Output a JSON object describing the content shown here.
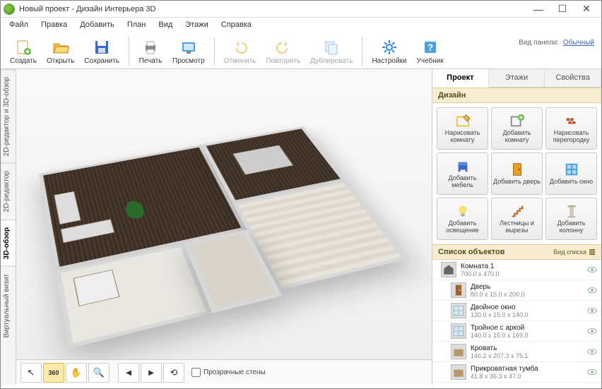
{
  "window": {
    "title": "Новый проект - Дизайн Интерьера 3D"
  },
  "menu": [
    "Файл",
    "Правка",
    "Добавить",
    "План",
    "Вид",
    "Этажи",
    "Справка"
  ],
  "toolbar": [
    {
      "id": "create",
      "label": "Создать",
      "icon": "#ffb030",
      "disabled": false
    },
    {
      "id": "open",
      "label": "Открыть",
      "icon": "#f0a020",
      "disabled": false
    },
    {
      "id": "save",
      "label": "Сохранить",
      "icon": "#2a5cc0",
      "disabled": false
    },
    {
      "sep": true
    },
    {
      "id": "print",
      "label": "Печать",
      "icon": "#888",
      "disabled": false
    },
    {
      "id": "view",
      "label": "Просмотр",
      "icon": "#2a8ad8",
      "disabled": false
    },
    {
      "sep": true
    },
    {
      "id": "undo",
      "label": "Отменить",
      "icon": "#f0a020",
      "disabled": true
    },
    {
      "id": "redo",
      "label": "Повторить",
      "icon": "#f0a020",
      "disabled": true
    },
    {
      "id": "duplicate",
      "label": "Дублировать",
      "icon": "#2a8ad8",
      "disabled": true
    },
    {
      "sep": true
    },
    {
      "id": "settings",
      "label": "Настройки",
      "icon": "#2a8ad8",
      "disabled": false
    },
    {
      "id": "tutorial",
      "label": "Учебник",
      "icon": "#2a8ad8",
      "disabled": false
    }
  ],
  "panelview": {
    "label": "Вид панели:",
    "value": "Обычный"
  },
  "sidetabs": [
    {
      "id": "2d-3d",
      "label": "2D-редактор и 3D-обзор",
      "active": false
    },
    {
      "id": "2d",
      "label": "2D-редактор",
      "active": false
    },
    {
      "id": "3d",
      "label": "3D-обзор",
      "active": true
    },
    {
      "id": "virtual",
      "label": "Виртуальный визит",
      "active": false
    }
  ],
  "viewtools": {
    "transparent_walls": "Прозрачные стены"
  },
  "tabs": [
    {
      "id": "project",
      "label": "Проект",
      "active": true
    },
    {
      "id": "floors",
      "label": "Этажи",
      "active": false
    },
    {
      "id": "props",
      "label": "Свойства",
      "active": false
    }
  ],
  "section_design": "Дизайн",
  "tools": [
    {
      "id": "draw-room",
      "label": "Нарисовать комнату",
      "color": "#e8c048"
    },
    {
      "id": "add-room",
      "label": "Добавить комнату",
      "color": "#48b048"
    },
    {
      "id": "draw-partition",
      "label": "Нарисовать перегородку",
      "color": "#c05030"
    },
    {
      "id": "add-furniture",
      "label": "Добавить мебель",
      "color": "#3a6ad0"
    },
    {
      "id": "add-door",
      "label": "Добавить дверь",
      "color": "#e8a020"
    },
    {
      "id": "add-window",
      "label": "Добавить окно",
      "color": "#40a0e0"
    },
    {
      "id": "add-light",
      "label": "Добавить освещение",
      "color": "#f0d020"
    },
    {
      "id": "stairs",
      "label": "Лестницы и вырезы",
      "color": "#c07030"
    },
    {
      "id": "add-column",
      "label": "Добавить колонну",
      "color": "#b8b0a0"
    }
  ],
  "objects_header": "Список объектов",
  "objects_viewmode": "Вид списка",
  "objects": [
    {
      "name": "Комната 1",
      "dim": "700.0 x 470.0",
      "kind": "room"
    },
    {
      "name": "Дверь",
      "dim": "80.0 x 15.0 x 200.0",
      "kind": "door"
    },
    {
      "name": "Двойное окно",
      "dim": "130.0 x 15.0 x 140.0",
      "kind": "window"
    },
    {
      "name": "Тройное с аркой",
      "dim": "140.0 x 15.0 x 169.0",
      "kind": "window"
    },
    {
      "name": "Кровать",
      "dim": "146.2 x 207.3 x 75.1",
      "kind": "furniture"
    },
    {
      "name": "Прикроватная тумба",
      "dim": "41.8 x 36.3 x 47.0",
      "kind": "furniture"
    }
  ]
}
